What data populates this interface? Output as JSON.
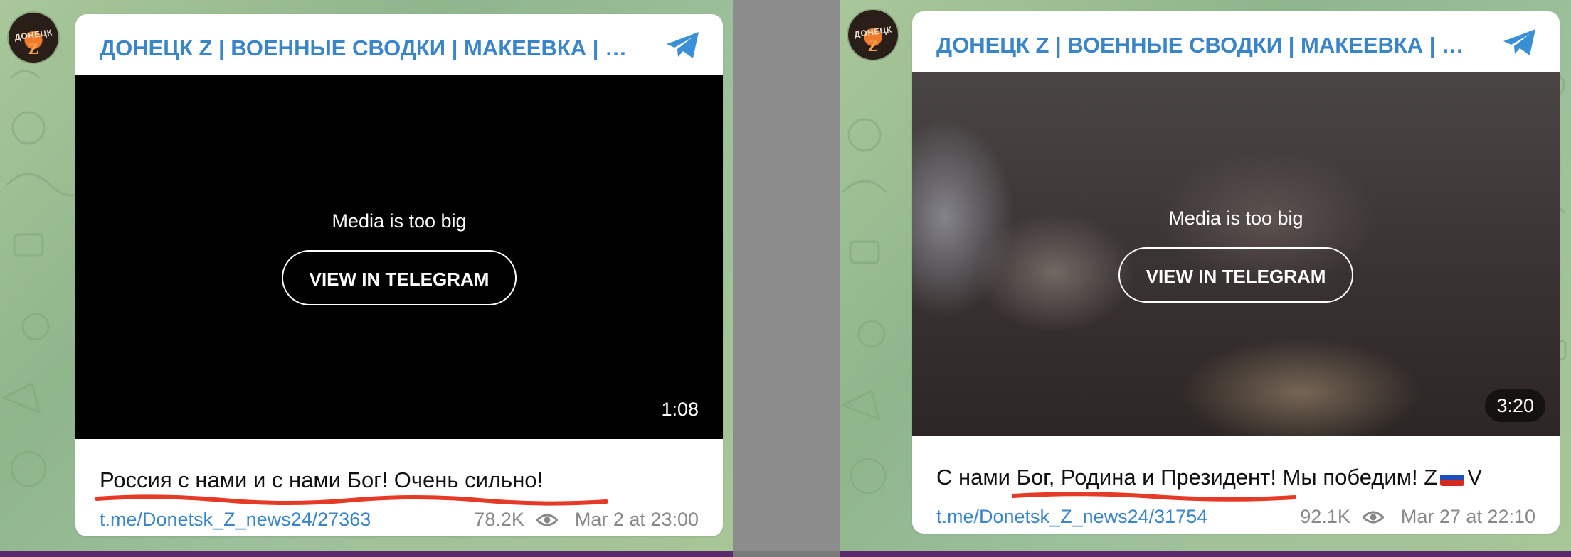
{
  "posts": [
    {
      "channel_title": "ДОНЕЦК Z | ВОЕННЫЕ СВОДКИ | МАКЕЕВКА | НО...",
      "media_message": "Media is too big",
      "view_button": "VIEW IN TELEGRAM",
      "duration": "1:08",
      "caption": "Россия с нами и с нами Бог! Очень сильно!",
      "link": "t.me/Donetsk_Z_news24/27363",
      "views": "78.2K",
      "date": "Mar 2 at 23:00",
      "avatar_text": "ДОНЕЦК",
      "avatar_letter": "Z"
    },
    {
      "channel_title": "ДОНЕЦК Z | ВОЕННЫЕ СВОДКИ | МАКЕЕВКА | НО...",
      "media_message": "Media is too big",
      "view_button": "VIEW IN TELEGRAM",
      "duration": "3:20",
      "caption_before": "С нами Бог, Родина и Президент! Мы победим! Z",
      "caption_after": "V",
      "link": "t.me/Donetsk_Z_news24/31754",
      "views": "92.1K",
      "date": "Mar 27 at 22:10",
      "avatar_text": "ДОНЕЦК",
      "avatar_letter": "Z"
    }
  ],
  "colors": {
    "accent": "#3a84c9",
    "highlight_underline": "#e53a25",
    "background_pattern": "#9cc09a"
  },
  "icons": [
    "telegram-icon",
    "eye-icon",
    "russia-flag-icon"
  ]
}
